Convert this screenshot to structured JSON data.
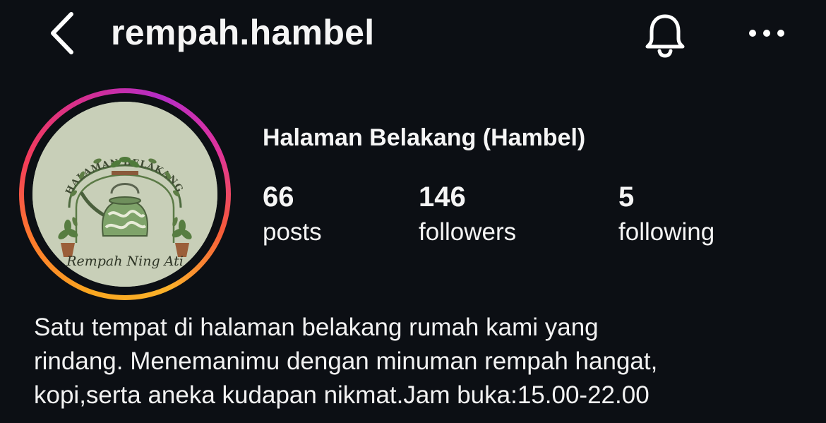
{
  "header": {
    "username": "rempah.hambel",
    "back_icon": "chevron-left-icon",
    "bell_icon": "bell-icon",
    "more_icon": "more-horizontal-icon"
  },
  "profile": {
    "display_name": "Halaman Belakang (Hambel)",
    "avatar": {
      "arch_text": "HALAMAN BELAKANG",
      "script_text": "Rempah Ning Ati",
      "ring_colors": [
        "#f9a620",
        "#f33b5b",
        "#b52dc7"
      ]
    },
    "stats": {
      "posts": {
        "value": "66",
        "label": "posts"
      },
      "followers": {
        "value": "146",
        "label": "followers"
      },
      "following": {
        "value": "5",
        "label": "following"
      }
    },
    "bio_lines": [
      "Satu tempat di halaman belakang rumah kami yang",
      "rindang. Menemanimu dengan minuman rempah hangat,",
      "kopi,serta aneka kudapan nikmat.Jam buka:15.00-22.00"
    ]
  }
}
